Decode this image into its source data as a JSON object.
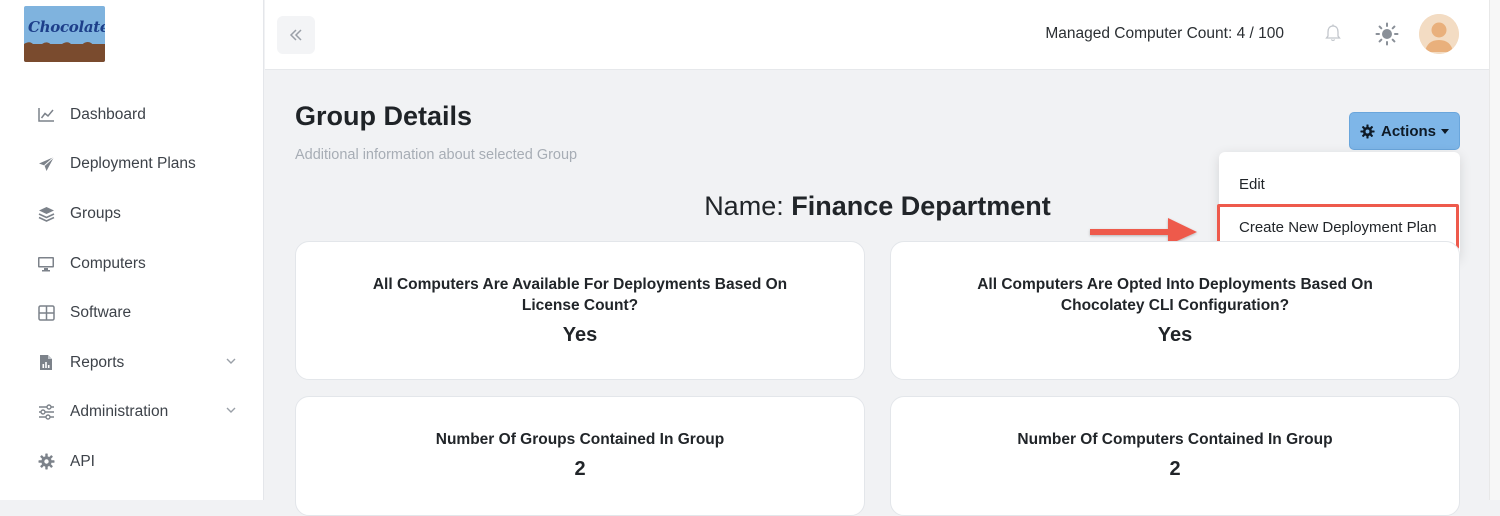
{
  "brand": {
    "logo_text": "Chocolatey"
  },
  "sidebar": {
    "items": [
      {
        "label": "Dashboard",
        "icon": "chart-line-icon"
      },
      {
        "label": "Deployment Plans",
        "icon": "paper-plane-icon"
      },
      {
        "label": "Groups",
        "icon": "layers-icon"
      },
      {
        "label": "Computers",
        "icon": "desktop-icon"
      },
      {
        "label": "Software",
        "icon": "grid-icon"
      },
      {
        "label": "Reports",
        "icon": "file-report-icon",
        "has_submenu": true
      },
      {
        "label": "Administration",
        "icon": "sliders-icon",
        "has_submenu": true
      },
      {
        "label": "API",
        "icon": "gear-icon"
      }
    ]
  },
  "topbar": {
    "managed_count": "Managed Computer Count: 4 / 100"
  },
  "page": {
    "title": "Group Details",
    "subtitle": "Additional information about selected Group",
    "name_label": "Name:",
    "name_value": "Finance Department"
  },
  "actions": {
    "label": "Actions",
    "menu": [
      {
        "label": "Edit"
      },
      {
        "label": "Create New Deployment Plan",
        "highlighted": true
      }
    ]
  },
  "cards": [
    {
      "title": "All Computers Are Available For Deployments Based On License Count?",
      "value": "Yes"
    },
    {
      "title": "All Computers Are Opted Into Deployments Based On Chocolatey CLI Configuration?",
      "value": "Yes"
    },
    {
      "title": "Number Of Groups Contained In Group",
      "value": "2"
    },
    {
      "title": "Number Of Computers Contained In Group",
      "value": "2"
    }
  ],
  "colors": {
    "actions_button": "#7eb6e8",
    "highlight_box": "#ee5a4c",
    "annotation_arrow": "#ee5a4c",
    "sidebar_bg": "#ffffff",
    "content_bg": "#f1f2f4"
  }
}
